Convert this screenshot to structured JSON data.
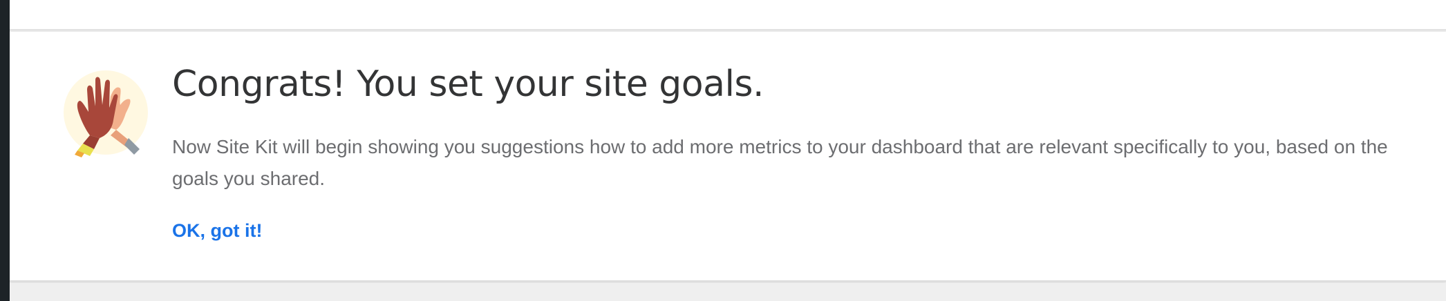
{
  "notice": {
    "title": "Congrats! You set your site goals.",
    "description": "Now Site Kit will begin showing you suggestions how to add more metrics to your dashboard that are relevant specifically to you, based on the goals you shared.",
    "cta_label": "OK, got it!",
    "illustration_icon": "high-five-icon"
  },
  "colors": {
    "title": "#333435",
    "description": "#6c6d70",
    "link": "#1a73e8",
    "card_background": "#ffffff",
    "page_background": "#f1f1f1"
  }
}
